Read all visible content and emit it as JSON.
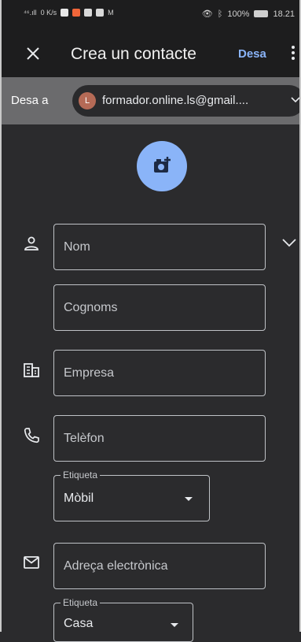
{
  "status": {
    "net": "⁴⁶.ıll",
    "speed": "0 K/s",
    "battery": "100%",
    "time": "18.21"
  },
  "header": {
    "title": "Crea un contacte",
    "save_label": "Desa"
  },
  "account": {
    "label": "Desa a",
    "avatar_letter": "L",
    "email": "formador.online.ls@gmail...."
  },
  "fields": {
    "first_name": "Nom",
    "last_name": "Cognoms",
    "company": "Empresa",
    "phone": "Telèfon",
    "phone_label_legend": "Etiqueta",
    "phone_label_value": "Mòbil",
    "email": "Adreça electrònica",
    "email_label_legend": "Etiqueta",
    "email_label_value": "Casa"
  },
  "colors": {
    "accent": "#8ab4f8",
    "background": "#2b2b2d",
    "bar": "#1d1d1e",
    "account_strip": "#6b6b6d"
  }
}
